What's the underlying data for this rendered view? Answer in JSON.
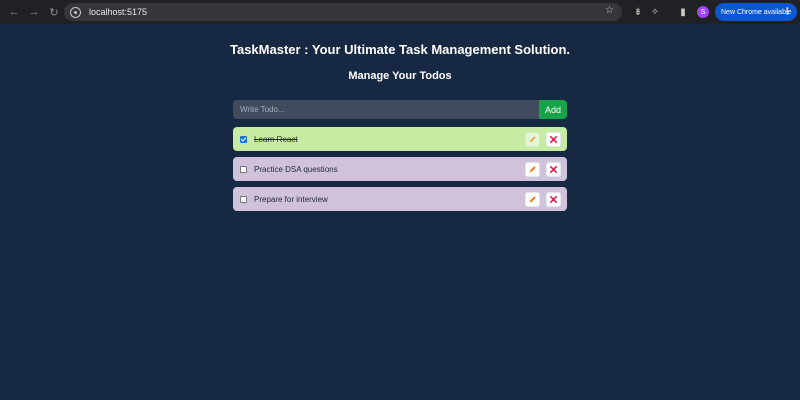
{
  "browser": {
    "url": "localhost:5175",
    "profile_initial": "S",
    "update_label": "New Chrome available"
  },
  "app": {
    "title": "TaskMaster : Your Ultimate Task Management Solution.",
    "subtitle": "Manage Your Todos",
    "input_placeholder": "Write Todo...",
    "add_label": "Add"
  },
  "todos": [
    {
      "text": "Learn React",
      "completed": true
    },
    {
      "text": "Practice DSA questions",
      "completed": false
    },
    {
      "text": "Prepare for interview",
      "completed": false
    }
  ],
  "icons": {
    "edit": "pencil-icon",
    "delete": "close-icon"
  },
  "colors": {
    "background": "#172842",
    "completed_row": "#c7eba2",
    "pending_row": "#d1c2dc",
    "add_button": "#16a34a",
    "delete_x": "#e11d48",
    "pencil": "#f97316"
  }
}
